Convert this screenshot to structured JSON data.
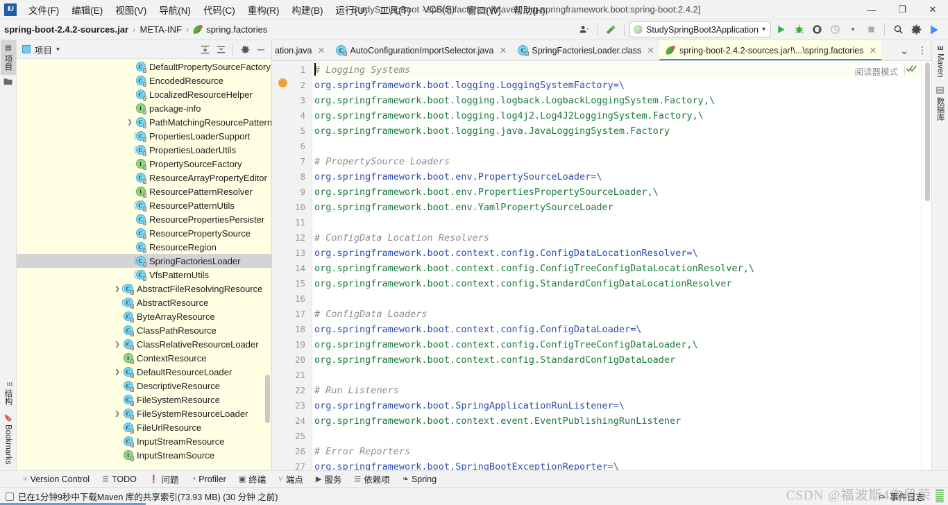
{
  "window": {
    "title": "StudySpringBoot - spring.factories [Maven: org.springframework.boot:spring-boot:2.4.2]",
    "minimize": "—",
    "maximize": "❐",
    "close": "✕",
    "logo": "IU"
  },
  "menubar": [
    {
      "label": "文件(F)"
    },
    {
      "label": "编辑(E)"
    },
    {
      "label": "视图(V)"
    },
    {
      "label": "导航(N)"
    },
    {
      "label": "代码(C)"
    },
    {
      "label": "重构(R)"
    },
    {
      "label": "构建(B)"
    },
    {
      "label": "运行(U)"
    },
    {
      "label": "工具(T)"
    },
    {
      "label": "VCS(S)"
    },
    {
      "label": "窗口(W)"
    },
    {
      "label": "帮助(H)"
    }
  ],
  "navbar": {
    "crumbs": [
      {
        "label": "spring-boot-2.4.2-sources.jar",
        "bold": true
      },
      {
        "label": "META-INF",
        "bold": false
      },
      {
        "label": "spring.factories",
        "bold": false,
        "icon": "spring-leaf-icon"
      }
    ],
    "separator": "›",
    "profile_icon": "user-profile-icon",
    "hammer_icon": "build-hammer-icon",
    "run_config": "StudySpringBoot3Application",
    "run_icon": "run-icon",
    "debug_icon": "debug-icon",
    "run_coverage_icon": "run-with-coverage-icon",
    "profile_run_icon": "profiler-run-icon",
    "stop_icon": "stop-icon",
    "search_icon": "search-everywhere-icon",
    "settings_icon": "settings-gear-icon",
    "updates_icon": "ide-updates-icon",
    "dropdown_caret": "▾"
  },
  "left_rail": {
    "top": [
      {
        "label": "项目",
        "icon": "project-icon",
        "active": true
      }
    ],
    "bottom": [
      {
        "label": "结构",
        "icon": "structure-icon"
      },
      {
        "label": "Bookmarks",
        "icon": "bookmark-icon"
      }
    ]
  },
  "right_rail": [
    {
      "label": "Maven",
      "icon": "maven-icon"
    },
    {
      "label": "数据库",
      "icon": "database-icon"
    }
  ],
  "project_panel": {
    "title": "项目",
    "title_caret": "▾",
    "actions": [
      {
        "name": "expand-all-button",
        "glyph": "↧"
      },
      {
        "name": "collapse-all-button",
        "glyph": "↥"
      },
      {
        "name": "settings-gear-button",
        "glyph": "⚙"
      },
      {
        "name": "hide-panel-button",
        "glyph": "—"
      }
    ],
    "tree": [
      {
        "label": "DefaultPropertySourceFactory",
        "type": "class",
        "indent": 2,
        "arrow": false
      },
      {
        "label": "EncodedResource",
        "type": "class",
        "indent": 2,
        "arrow": false
      },
      {
        "label": "LocalizedResourceHelper",
        "type": "class",
        "indent": 2,
        "arrow": false
      },
      {
        "label": "package-info",
        "type": "interface",
        "indent": 2,
        "arrow": false
      },
      {
        "label": "PathMatchingResourcePatternRe",
        "type": "class",
        "indent": 2,
        "arrow": true
      },
      {
        "label": "PropertiesLoaderSupport",
        "type": "abstract",
        "indent": 2,
        "arrow": false
      },
      {
        "label": "PropertiesLoaderUtils",
        "type": "abstract",
        "indent": 2,
        "arrow": false
      },
      {
        "label": "PropertySourceFactory",
        "type": "interface",
        "indent": 2,
        "arrow": false
      },
      {
        "label": "ResourceArrayPropertyEditor",
        "type": "class",
        "indent": 2,
        "arrow": false
      },
      {
        "label": "ResourcePatternResolver",
        "type": "interface",
        "indent": 2,
        "arrow": false
      },
      {
        "label": "ResourcePatternUtils",
        "type": "abstract",
        "indent": 2,
        "arrow": false
      },
      {
        "label": "ResourcePropertiesPersister",
        "type": "class",
        "indent": 2,
        "arrow": false
      },
      {
        "label": "ResourcePropertySource",
        "type": "class",
        "indent": 2,
        "arrow": false
      },
      {
        "label": "ResourceRegion",
        "type": "class",
        "indent": 2,
        "arrow": false
      },
      {
        "label": "SpringFactoriesLoader",
        "type": "abstract",
        "indent": 2,
        "arrow": false,
        "selected": true
      },
      {
        "label": "VfsPatternUtils",
        "type": "abstract",
        "indent": 2,
        "arrow": false
      },
      {
        "label": "AbstractFileResolvingResource",
        "type": "abstract",
        "indent": 1,
        "arrow": true
      },
      {
        "label": "AbstractResource",
        "type": "abstract",
        "indent": 1,
        "arrow": false
      },
      {
        "label": "ByteArrayResource",
        "type": "class",
        "indent": 1,
        "arrow": false
      },
      {
        "label": "ClassPathResource",
        "type": "class",
        "indent": 1,
        "arrow": false
      },
      {
        "label": "ClassRelativeResourceLoader",
        "type": "class",
        "indent": 1,
        "arrow": true
      },
      {
        "label": "ContextResource",
        "type": "interface",
        "indent": 1,
        "arrow": false
      },
      {
        "label": "DefaultResourceLoader",
        "type": "class",
        "indent": 1,
        "arrow": true
      },
      {
        "label": "DescriptiveResource",
        "type": "class",
        "indent": 1,
        "arrow": false
      },
      {
        "label": "FileSystemResource",
        "type": "class",
        "indent": 1,
        "arrow": false
      },
      {
        "label": "FileSystemResourceLoader",
        "type": "class",
        "indent": 1,
        "arrow": true
      },
      {
        "label": "FileUrlResource",
        "type": "class",
        "indent": 1,
        "arrow": false
      },
      {
        "label": "InputStreamResource",
        "type": "class",
        "indent": 1,
        "arrow": false
      },
      {
        "label": "InputStreamSource",
        "type": "interface",
        "indent": 1,
        "arrow": false
      }
    ]
  },
  "tabs": [
    {
      "label": "ation.java",
      "icon": "java-class-icon",
      "active": false,
      "truncated_left": true
    },
    {
      "label": "AutoConfigurationImportSelector.java",
      "icon": "java-class-icon",
      "active": false
    },
    {
      "label": "SpringFactoriesLoader.class",
      "icon": "java-class-icon",
      "active": false
    },
    {
      "label": "spring-boot-2.4.2-sources.jar!\\...\\spring.factories",
      "icon": "spring-leaf-icon",
      "active": true
    }
  ],
  "tab_actions": {
    "show_list": "⌄",
    "more": "⋮"
  },
  "editor": {
    "reader_mode": "阅读器模式",
    "inspection_ok": "✓✓",
    "first_line": 1,
    "lines": [
      {
        "n": 1,
        "type": "comment",
        "text": "# Logging Systems"
      },
      {
        "n": 2,
        "type": "prop",
        "key": "org.springframework.boot.logging.LoggingSystemFactory=\\",
        "val": ""
      },
      {
        "n": 3,
        "type": "value",
        "text": "org.springframework.boot.logging.logback.LogbackLoggingSystem.Factory,\\"
      },
      {
        "n": 4,
        "type": "value",
        "text": "org.springframework.boot.logging.log4j2.Log4J2LoggingSystem.Factory,\\"
      },
      {
        "n": 5,
        "type": "value",
        "text": "org.springframework.boot.logging.java.JavaLoggingSystem.Factory"
      },
      {
        "n": 6,
        "type": "blank",
        "text": ""
      },
      {
        "n": 7,
        "type": "comment",
        "text": "# PropertySource Loaders"
      },
      {
        "n": 8,
        "type": "prop",
        "key": "org.springframework.boot.env.PropertySourceLoader=\\",
        "val": ""
      },
      {
        "n": 9,
        "type": "value",
        "text": "org.springframework.boot.env.PropertiesPropertySourceLoader,\\"
      },
      {
        "n": 10,
        "type": "value",
        "text": "org.springframework.boot.env.YamlPropertySourceLoader"
      },
      {
        "n": 11,
        "type": "blank",
        "text": ""
      },
      {
        "n": 12,
        "type": "comment",
        "text": "# ConfigData Location Resolvers"
      },
      {
        "n": 13,
        "type": "prop",
        "key": "org.springframework.boot.context.config.ConfigDataLocationResolver=\\",
        "val": ""
      },
      {
        "n": 14,
        "type": "value",
        "text": "org.springframework.boot.context.config.ConfigTreeConfigDataLocationResolver,\\"
      },
      {
        "n": 15,
        "type": "value",
        "text": "org.springframework.boot.context.config.StandardConfigDataLocationResolver"
      },
      {
        "n": 16,
        "type": "blank",
        "text": ""
      },
      {
        "n": 17,
        "type": "comment",
        "text": "# ConfigData Loaders"
      },
      {
        "n": 18,
        "type": "prop",
        "key": "org.springframework.boot.context.config.ConfigDataLoader=\\",
        "val": ""
      },
      {
        "n": 19,
        "type": "value",
        "text": "org.springframework.boot.context.config.ConfigTreeConfigDataLoader,\\"
      },
      {
        "n": 20,
        "type": "value",
        "text": "org.springframework.boot.context.config.StandardConfigDataLoader"
      },
      {
        "n": 21,
        "type": "blank",
        "text": ""
      },
      {
        "n": 22,
        "type": "comment",
        "text": "# Run Listeners"
      },
      {
        "n": 23,
        "type": "prop",
        "key": "org.springframework.boot.SpringApplicationRunListener=\\",
        "val": ""
      },
      {
        "n": 24,
        "type": "value",
        "text": "org.springframework.boot.context.event.EventPublishingRunListener"
      },
      {
        "n": 25,
        "type": "blank",
        "text": ""
      },
      {
        "n": 26,
        "type": "comment",
        "text": "# Error Reporters"
      },
      {
        "n": 27,
        "type": "prop",
        "key": "org.springframework.boot.SpringBootExceptionReporter=\\",
        "val": ""
      }
    ]
  },
  "tool_windows": [
    {
      "label": "Version Control",
      "icon": "branch-icon",
      "glyph": "⑂"
    },
    {
      "label": "TODO",
      "icon": "todo-list-icon",
      "glyph": "☰"
    },
    {
      "label": "问题",
      "icon": "problems-icon",
      "glyph": "❗"
    },
    {
      "label": "Profiler",
      "icon": "profiler-icon",
      "glyph": "◔"
    },
    {
      "label": "终端",
      "icon": "terminal-icon",
      "glyph": "▣"
    },
    {
      "label": "端点",
      "icon": "endpoints-icon",
      "glyph": "⑂"
    },
    {
      "label": "服务",
      "icon": "services-icon",
      "glyph": "▶"
    },
    {
      "label": "依赖项",
      "icon": "dependencies-icon",
      "glyph": "☰"
    },
    {
      "label": "Spring",
      "icon": "spring-leaf-icon",
      "glyph": "❧"
    }
  ],
  "status": {
    "message": "已在1分钟9秒中下载Maven 库的共享索引(73.93 MB) (30 分钟 之前)",
    "event_log": "事件日志",
    "event_log_icon": "event-log-icon",
    "watermark": "CSDN @福波斯4你段荣"
  },
  "colors": {
    "accent": "#3c8ddb",
    "editor_bg": "#ffffff",
    "panel_bg": "#ffffe4",
    "chrome_bg": "#f2f2f2",
    "comment": "#8c8c8c",
    "key": "#2c4fa8",
    "value": "#1a7a3c",
    "selection": "#d4d4d4"
  }
}
